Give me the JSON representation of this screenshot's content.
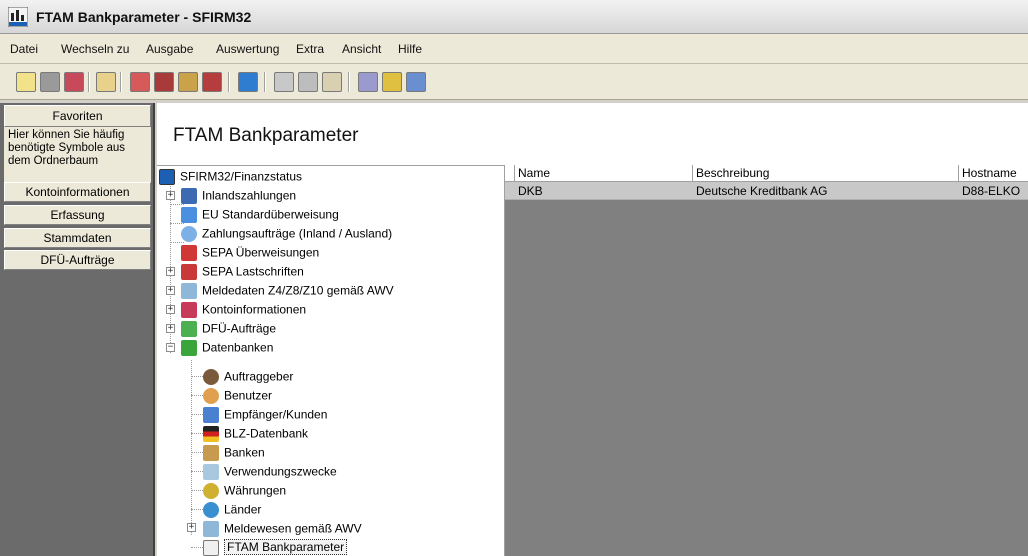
{
  "window": {
    "title": "FTAM Bankparameter - SFIRM32"
  },
  "menu": [
    "Datei",
    "Wechseln zu",
    "Ausgabe",
    "Auswertung",
    "Extra",
    "Ansicht",
    "Hilfe"
  ],
  "toolbar": {
    "icons": [
      "list-icon",
      "edit-icon",
      "save-icon",
      "properties-icon",
      "new-record-icon",
      "import-icon",
      "export-icon",
      "calendar-icon",
      "internet-icon",
      "cut-icon",
      "copy-icon",
      "paste-icon",
      "print-icon",
      "help-icon",
      "context-help-icon"
    ]
  },
  "sidebar": {
    "favorites_header": "Favoriten",
    "favorites_hint": "Hier können Sie häufig benötigte Symbole aus dem Ordnerbaum",
    "buttons": [
      "Kontoinformationen",
      "Erfassung",
      "Stammdaten",
      "DFÜ-Aufträge"
    ]
  },
  "main": {
    "title": "FTAM Bankparameter",
    "tree": [
      "SFIRM32/Finanzstatus",
      "Inlandszahlungen",
      "EU Standardüberweisung",
      "Zahlungsaufträge (Inland / Ausland)",
      "SEPA Überweisungen",
      "SEPA Lastschriften",
      "Meldedaten Z4/Z8/Z10 gemäß AWV",
      "Kontoinformationen",
      "DFÜ-Aufträge",
      "Datenbanken",
      "Auftraggeber",
      "Benutzer",
      "Empfänger/Kunden",
      "BLZ-Datenbank",
      "Banken",
      "Verwendungszwecke",
      "Währungen",
      "Länder",
      "Meldewesen gemäß AWV",
      "FTAM Bankparameter"
    ],
    "table": {
      "columns": [
        "Name",
        "Beschreibung",
        "Hostname"
      ],
      "rows": [
        [
          "DKB",
          "Deutsche Kreditbank AG",
          "D88-ELKO"
        ]
      ]
    }
  }
}
